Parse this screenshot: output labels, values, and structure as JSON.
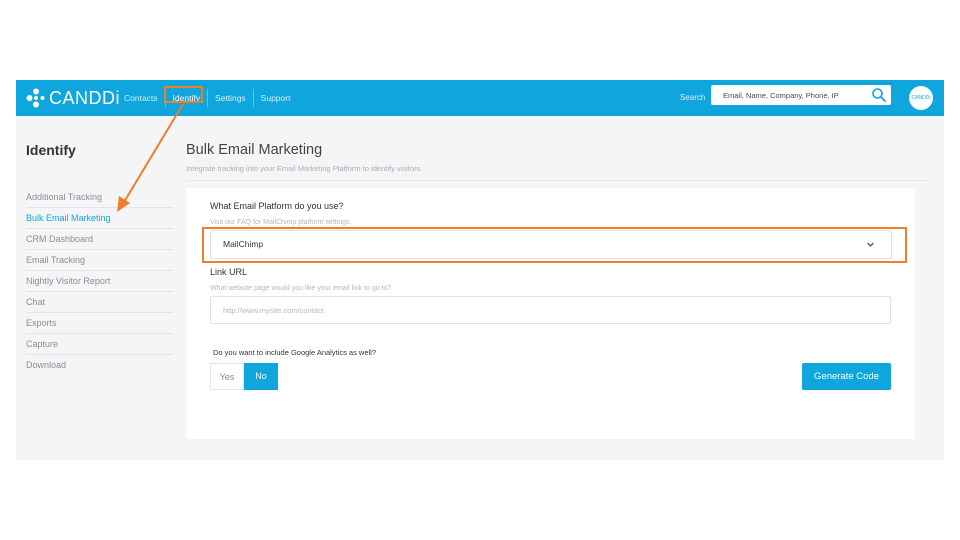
{
  "app": {
    "logo_text": "CANDDi",
    "brand_color": "#0ea6dc",
    "accent_annotation_color": "#ef7d2a"
  },
  "topbar": {
    "nav": [
      {
        "label": "Contacts",
        "active": false
      },
      {
        "label": "Identify",
        "active": true
      },
      {
        "label": "Settings",
        "active": false
      },
      {
        "label": "Support",
        "active": false
      }
    ],
    "search_label": "Search",
    "search_placeholder": "Email, Name, Company, Phone, IP",
    "search_icon": "search-icon",
    "avatar_text": "CANDDi"
  },
  "sidebar": {
    "title": "Identify",
    "items": [
      {
        "label": "Additional Tracking",
        "active": false
      },
      {
        "label": "Bulk Email Marketing",
        "active": true
      },
      {
        "label": "CRM Dashboard",
        "active": false
      },
      {
        "label": "Email Tracking",
        "active": false
      },
      {
        "label": "Nightly Visitor Report",
        "active": false
      },
      {
        "label": "Chat",
        "active": false
      },
      {
        "label": "Exports",
        "active": false
      },
      {
        "label": "Capture",
        "active": false
      },
      {
        "label": "Download",
        "active": false
      }
    ]
  },
  "main": {
    "title": "Bulk Email Marketing",
    "subtitle": "Integrate tracking into your Email Marketing Platform to identify visitors",
    "platform_question": "What Email Platform do you use?",
    "platform_hint": "Visit our FAQ for MailChimp platform settings.",
    "platform_selected": "MailChimp",
    "link_label": "Link URL",
    "link_hint": "What website page would you like your email link to go to?",
    "link_placeholder": "http://www.mysite.com/contact",
    "ga_question": "Do you want to include Google Analytics as well?",
    "ga_yes": "Yes",
    "ga_no": "No",
    "ga_selected": "No",
    "generate_button": "Generate Code"
  }
}
